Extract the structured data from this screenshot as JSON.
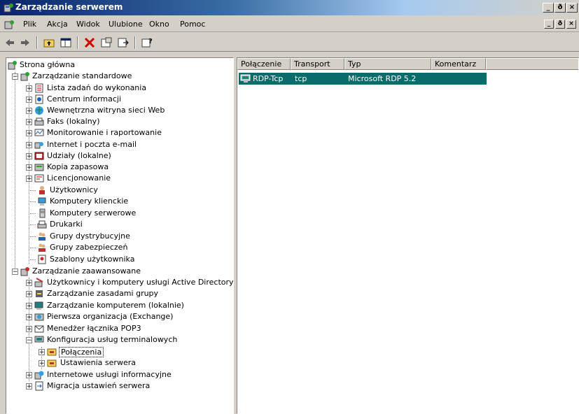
{
  "window": {
    "title": "Zarządzanie serwerem",
    "buttons": {
      "minimize": "_",
      "restore": "ð",
      "close": "×"
    }
  },
  "menu": {
    "items": [
      "Plik",
      "Akcja",
      "Widok",
      "Ulubione",
      "Okno",
      "Pomoc"
    ],
    "mdi_buttons": {
      "minimize": "_",
      "restore": "ð",
      "close": "×"
    }
  },
  "toolbar": {
    "icons": [
      "back-icon",
      "forward-icon",
      "up-folder-icon",
      "show-hide-tree-icon",
      "delete-icon",
      "properties-icon",
      "export-list-icon",
      "help-icon"
    ]
  },
  "tree": {
    "root": "Strona główna",
    "standard": {
      "label": "Zarządzanie standardowe",
      "children": [
        "Lista zadań do wykonania",
        "Centrum informacji",
        "Wewnętrzna witryna sieci Web",
        "Faks (lokalny)",
        "Monitorowanie i raportowanie",
        "Internet i poczta e-mail",
        "Udziały (lokalne)",
        "Kopia zapasowa",
        "Licencjonowanie",
        "Użytkownicy",
        "Komputery klienckie",
        "Komputery serwerowe",
        "Drukarki",
        "Grupy dystrybucyjne",
        "Grupy zabezpieczeń",
        "Szablony użytkownika"
      ]
    },
    "advanced": {
      "label": "Zarządzanie zaawansowane",
      "children": [
        "Użytkownicy i komputery usługi Active Directory",
        "Zarządzanie zasadami grupy",
        "Zarządzanie komputerem (lokalnie)",
        "Pierwsza organizacja (Exchange)",
        "Menedżer łącznika POP3",
        "Konfiguracja usług terminalowych"
      ],
      "terminal_children": [
        "Połączenia",
        "Ustawienia serwera"
      ],
      "after": [
        "Internetowe usługi informacyjne",
        "Migracja ustawień serwera"
      ]
    }
  },
  "list": {
    "columns": [
      "Połączenie",
      "Transport",
      "Typ",
      "Komentarz"
    ],
    "rows": [
      {
        "connection": "RDP-Tcp",
        "transport": "tcp",
        "type": "Microsoft RDP 5.2",
        "comment": ""
      }
    ]
  },
  "colors": {
    "selection": "#0a6b6b",
    "titlebar": "#0a246a"
  }
}
